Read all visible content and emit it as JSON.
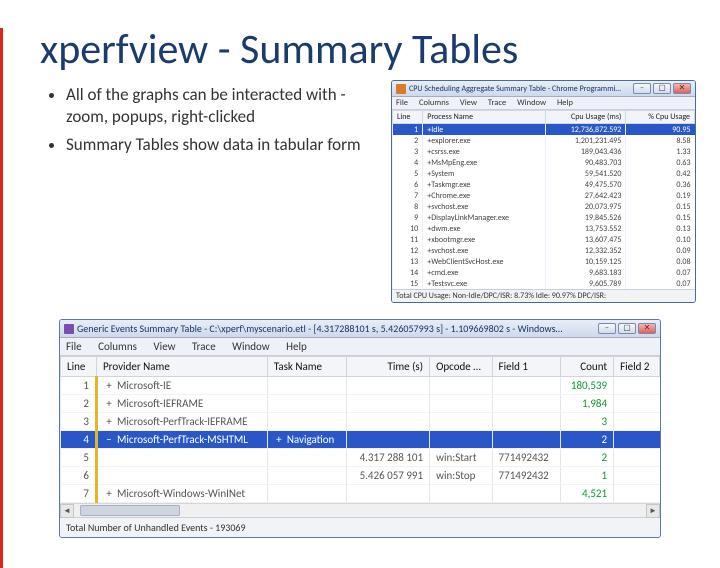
{
  "title": "xperfview - Summary Tables",
  "bullets": [
    "All of the graphs can be interacted with - zoom, popups, right-clicked",
    "Summary Tables show data in tabular form"
  ],
  "small_win": {
    "title": "CPU Scheduling Aggregate Summary Table - Chrome Programmi…",
    "menu": [
      "File",
      "Columns",
      "View",
      "Trace",
      "Window",
      "Help"
    ],
    "headers": {
      "line": "Line",
      "proc": "Process Name",
      "cpu": "Cpu Usage (ms)",
      "pct": "% Cpu Usage"
    },
    "rows": [
      {
        "line": "1",
        "exp": "+",
        "proc": "Idle",
        "cpu": "12,736,872.592",
        "pct": "90.95",
        "sel": true
      },
      {
        "line": "2",
        "exp": "+",
        "proc": "explorer.exe",
        "cpu": "1,201,231.495",
        "pct": "8.58"
      },
      {
        "line": "3",
        "exp": "+",
        "proc": "csrss.exe",
        "cpu": "189,043.436",
        "pct": "1.33"
      },
      {
        "line": "4",
        "exp": "+",
        "proc": "MsMpEng.exe",
        "cpu": "90,483.703",
        "pct": "0.63"
      },
      {
        "line": "5",
        "exp": "+",
        "proc": "System",
        "cpu": "59,541.520",
        "pct": "0.42"
      },
      {
        "line": "6",
        "exp": "+",
        "proc": "Taskmgr.exe",
        "cpu": "49,475.570",
        "pct": "0.36"
      },
      {
        "line": "7",
        "exp": "+",
        "proc": "Chrome.exe",
        "cpu": "27,642.423",
        "pct": "0.19"
      },
      {
        "line": "8",
        "exp": "+",
        "proc": "svchost.exe",
        "cpu": "20,073.975",
        "pct": "0.15"
      },
      {
        "line": "9",
        "exp": "+",
        "proc": "DisplayLinkManager.exe",
        "cpu": "19,845.526",
        "pct": "0.15"
      },
      {
        "line": "10",
        "exp": "+",
        "proc": "dwm.exe",
        "cpu": "13,753.552",
        "pct": "0.13"
      },
      {
        "line": "11",
        "exp": "+",
        "proc": "xbootmgr.exe",
        "cpu": "13,607.475",
        "pct": "0.10"
      },
      {
        "line": "12",
        "exp": "+",
        "proc": "svchost.exe",
        "cpu": "12,332.352",
        "pct": "0.09"
      },
      {
        "line": "13",
        "exp": "+",
        "proc": "WebClientSvcHost.exe",
        "cpu": "10,159.125",
        "pct": "0.08"
      },
      {
        "line": "14",
        "exp": "+",
        "proc": "cmd.exe",
        "cpu": "9,683.183",
        "pct": "0.07"
      },
      {
        "line": "15",
        "exp": "+",
        "proc": "Testsvc.exe",
        "cpu": "9,605.789",
        "pct": "0.07"
      }
    ],
    "footer": "Total CPU Usage:  Non-Idle/DPC/ISR: 8.73%   Idle: 90.97%   DPC/ISR:  "
  },
  "big_win": {
    "title": "Generic Events Summary Table - C:\\xperf\\myscenario.etl - [4.317288101 s, 5.426057993 s] - 1.109669802 s - Windows…",
    "menu": [
      "File",
      "Columns",
      "View",
      "Trace",
      "Window",
      "Help"
    ],
    "headers": {
      "line": "Line",
      "prov": "Provider Name",
      "task": "Task Name",
      "time": "Time (s)",
      "opc": "Opcode …",
      "f1": "Field 1",
      "count": "Count",
      "f2": "Field 2"
    },
    "rows": [
      {
        "line": "1",
        "exp": "+",
        "prov": "Microsoft-IE",
        "count": "180,539"
      },
      {
        "line": "2",
        "exp": "+",
        "prov": "Microsoft-IEFRAME",
        "count": "1,984"
      },
      {
        "line": "3",
        "exp": "+",
        "prov": "Microsoft-PerfTrack-IEFRAME",
        "count": "3"
      },
      {
        "line": "4",
        "exp": "−",
        "prov": "Microsoft-PerfTrack-MSHTML",
        "task": "Navigation",
        "count": "2",
        "sel": true,
        "taskExp": true
      },
      {
        "line": "5",
        "time": "4.317 288 101",
        "opc": "win:Start",
        "f1": "771492432",
        "count": "2",
        "sub": true
      },
      {
        "line": "6",
        "time": "5.426 057 991",
        "opc": "win:Stop",
        "f1": "771492432",
        "count": "1",
        "sub": true
      },
      {
        "line": "7",
        "exp": "+",
        "prov": "Microsoft-Windows-WinINet",
        "count": "4,521"
      }
    ],
    "footer": "Total Number of Unhandled Events - 193069"
  }
}
